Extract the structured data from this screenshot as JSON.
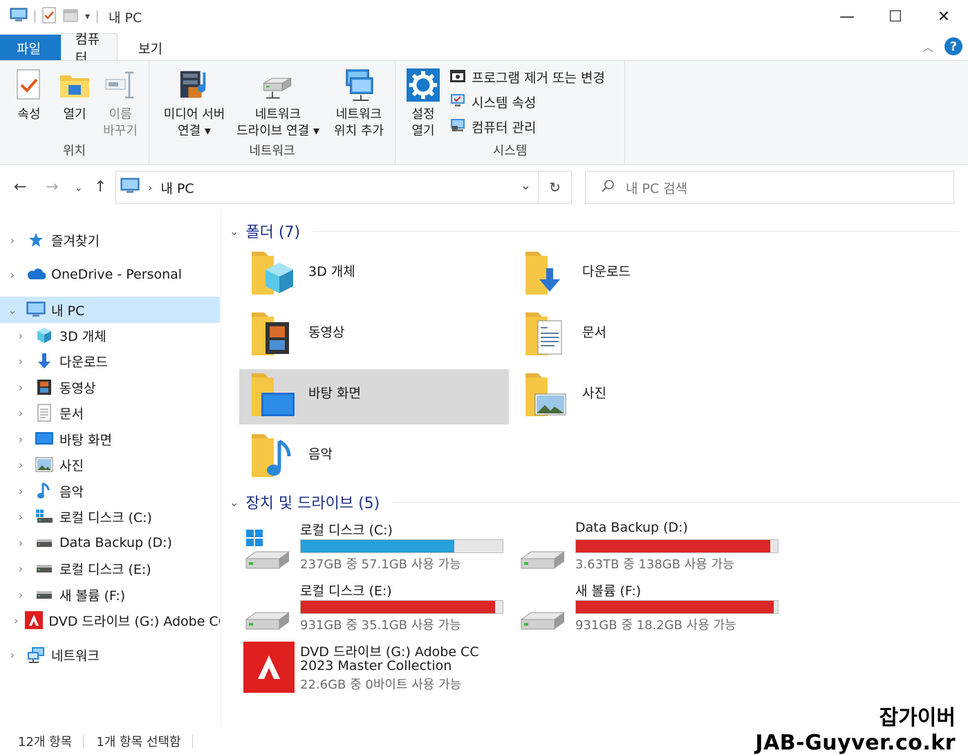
{
  "window": {
    "title": "내 PC",
    "minimize_glyph": "—",
    "maximize_glyph": "☐",
    "close_glyph": "✕"
  },
  "ribbon": {
    "tabs": [
      {
        "label": "파일"
      },
      {
        "label": "컴퓨터"
      },
      {
        "label": "보기"
      }
    ],
    "help_glyph": "?",
    "groups": {
      "location": {
        "label": "위치",
        "buttons": [
          {
            "label": "속성",
            "icon": "properties-icon"
          },
          {
            "label": "열기",
            "icon": "open-folder-icon"
          },
          {
            "label": "이름 바꾸기",
            "line1": "이름",
            "line2": "바꾸기",
            "icon": "rename-icon"
          }
        ]
      },
      "network": {
        "label": "네트워크",
        "buttons": [
          {
            "line1": "미디어 서버",
            "line2": "연결 ▾",
            "icon": "media-server-icon"
          },
          {
            "line1": "네트워크",
            "line2": "드라이브 연결 ▾",
            "icon": "map-network-drive-icon"
          },
          {
            "line1": "네트워크",
            "line2": "위치 추가",
            "icon": "add-network-location-icon"
          }
        ]
      },
      "system": {
        "label": "시스템",
        "open_settings": {
          "line1": "설정",
          "line2": "열기",
          "icon": "settings-gear-icon"
        },
        "items": [
          {
            "label": "프로그램 제거 또는 변경",
            "icon": "uninstall-icon"
          },
          {
            "label": "시스템 속성",
            "icon": "system-properties-icon"
          },
          {
            "label": "컴퓨터 관리",
            "icon": "computer-management-icon"
          }
        ]
      }
    }
  },
  "address": {
    "path_label": "내 PC",
    "search_placeholder": "내 PC 검색"
  },
  "nav_pane": {
    "items": [
      {
        "label": "즐겨찾기",
        "icon": "star-icon",
        "level": 0
      },
      {
        "label": "OneDrive - Personal",
        "icon": "cloud-icon",
        "level": 0
      },
      {
        "label": "내 PC",
        "icon": "pc-icon",
        "level": 0,
        "selected": true,
        "expanded": true
      },
      {
        "label": "3D 개체",
        "icon": "3d-objects-icon",
        "level": 1
      },
      {
        "label": "다운로드",
        "icon": "download-arrow-icon",
        "level": 1
      },
      {
        "label": "동영상",
        "icon": "film-icon",
        "level": 1
      },
      {
        "label": "문서",
        "icon": "document-icon",
        "level": 1
      },
      {
        "label": "바탕 화면",
        "icon": "desktop-icon",
        "level": 1
      },
      {
        "label": "사진",
        "icon": "picture-icon",
        "level": 1
      },
      {
        "label": "음악",
        "icon": "music-note-icon",
        "level": 1
      },
      {
        "label": "로컬 디스크 (C:)",
        "icon": "windows-drive-icon",
        "level": 1
      },
      {
        "label": "Data Backup (D:)",
        "icon": "drive-icon",
        "level": 1
      },
      {
        "label": "로컬 디스크 (E:)",
        "icon": "drive-icon",
        "level": 1
      },
      {
        "label": "새 볼륨 (F:)",
        "icon": "drive-icon",
        "level": 1
      },
      {
        "label": "DVD 드라이브 (G:) Adobe CC",
        "icon": "adobe-icon",
        "level": 1
      },
      {
        "label": "네트워크",
        "icon": "network-icon",
        "level": 0
      }
    ]
  },
  "folders": {
    "heading": "폴더 (7)",
    "items": [
      {
        "label": "3D 개체",
        "icon": "folder-3d-icon"
      },
      {
        "label": "다운로드",
        "icon": "folder-download-icon"
      },
      {
        "label": "동영상",
        "icon": "folder-video-icon"
      },
      {
        "label": "문서",
        "icon": "folder-document-icon"
      },
      {
        "label": "바탕 화면",
        "icon": "folder-desktop-icon",
        "selected": true
      },
      {
        "label": "사진",
        "icon": "folder-picture-icon"
      },
      {
        "label": "음악",
        "icon": "folder-music-icon"
      }
    ]
  },
  "drives": {
    "heading": "장치 및 드라이브 (5)",
    "items": [
      {
        "label": "로컬 디스크 (C:)",
        "free_text": "237GB 중 57.1GB 사용 가능",
        "used_fraction": 0.759,
        "bar_color": "#26a0da",
        "icon": "windows-drive-icon"
      },
      {
        "label": "Data Backup (D:)",
        "free_text": "3.63TB 중 138GB 사용 가능",
        "used_fraction": 0.963,
        "bar_color": "#da2626",
        "icon": "drive-icon"
      },
      {
        "label": "로컬 디스크 (E:)",
        "free_text": "931GB 중 35.1GB 사용 가능",
        "used_fraction": 0.962,
        "bar_color": "#da2626",
        "icon": "drive-icon"
      },
      {
        "label": "새 볼륨 (F:)",
        "free_text": "931GB 중 18.2GB 사용 가능",
        "used_fraction": 0.98,
        "bar_color": "#da2626",
        "icon": "drive-icon"
      }
    ],
    "dvd": {
      "line1": "DVD 드라이브 (G:) Adobe CC",
      "line2": "2023 Master Collection",
      "free_text": "22.6GB 중 0바이트 사용 가능",
      "icon": "adobe-icon"
    }
  },
  "status_bar": {
    "item_count": "12개 항목",
    "selection": "1개 항목 선택함"
  },
  "watermark": {
    "line1": "잡가이버",
    "line2": "JAB-Guyver.co.kr"
  },
  "colors": {
    "accent": "#1979ca",
    "selection": "#cce8ff",
    "free_bar_ok": "#26a0da",
    "free_bar_low": "#da2626",
    "heading": "#1e3287",
    "folder": "#f6c744"
  }
}
